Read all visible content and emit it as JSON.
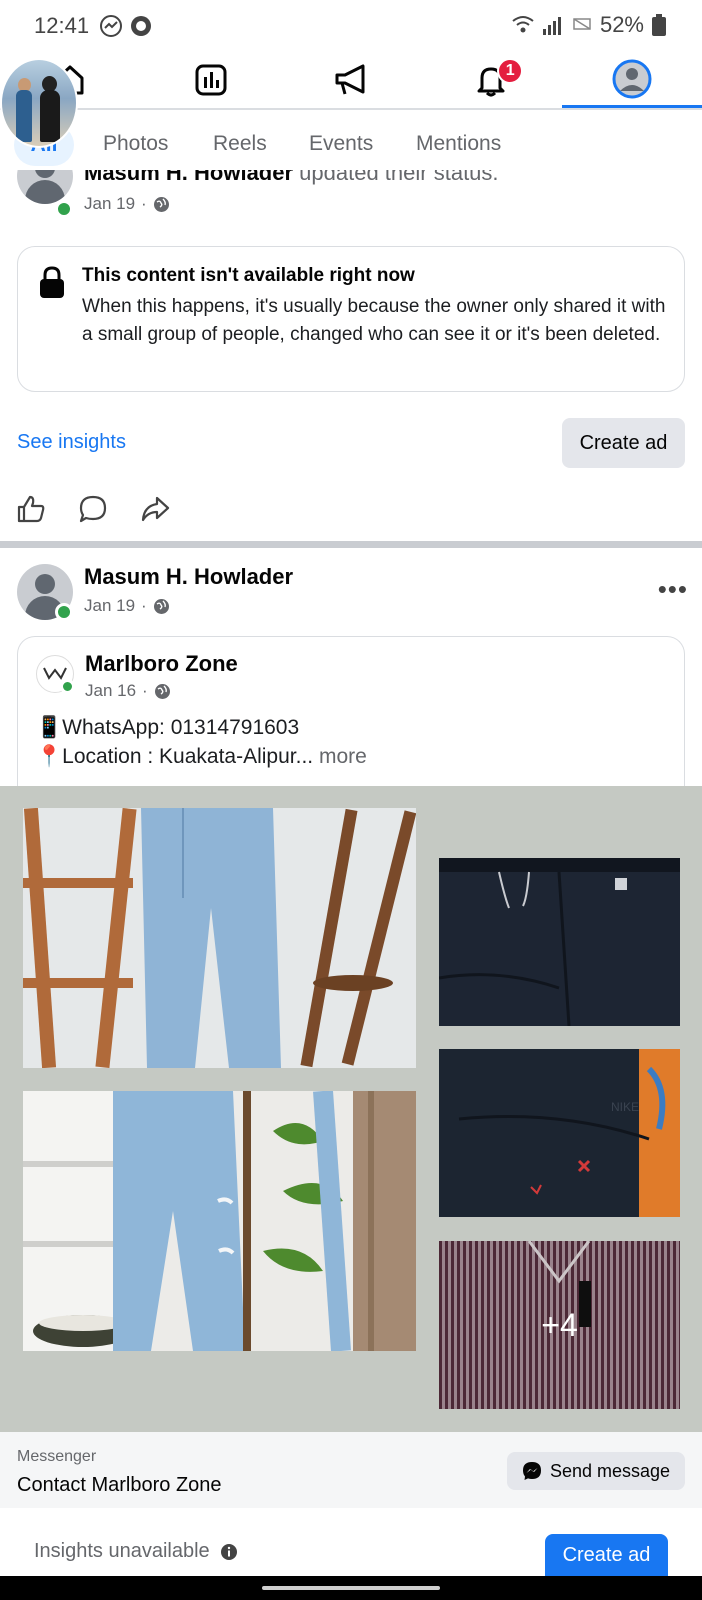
{
  "status_bar": {
    "time": "12:41",
    "battery": "52%"
  },
  "nav": {
    "notifications_badge": "1"
  },
  "tabs": {
    "active": "All",
    "items": [
      "Photos",
      "Reels",
      "Events",
      "Mentions"
    ]
  },
  "post1": {
    "author": "Masum H. Howlader",
    "action": "updated their status.",
    "date": "Jan 19",
    "notice": {
      "title": "This content isn't available right now",
      "body": "When this happens, it's usually because the owner only shared it with a small group of people, changed who can see it or it's been deleted."
    },
    "see_insights": "See insights",
    "create_ad": "Create ad"
  },
  "post2": {
    "author": "Masum H. Howlader",
    "date": "Jan 19",
    "shared": {
      "page_name": "Marlboro Zone",
      "date": "Jan 16",
      "line1": "📱WhatsApp: 01314791603",
      "line2": "📍Location : Kuakata-Alipur...",
      "more": "more",
      "extra_photos": "+4"
    },
    "messenger": {
      "label": "Messenger",
      "contact": "Contact Marlboro Zone",
      "send": "Send message"
    },
    "insights_unavailable": "Insights unavailable",
    "create_ad": "Create ad"
  },
  "colors": {
    "accent": "#1877f2",
    "badge": "#e41e3f",
    "online": "#31a24c"
  }
}
